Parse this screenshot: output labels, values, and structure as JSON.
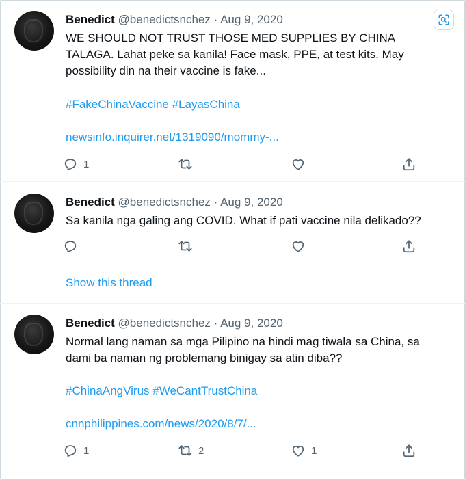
{
  "tweets": [
    {
      "name": "Benedict",
      "meta": "@benedictsnchez · Aug 9, 2020",
      "lines": [
        "WE SHOULD NOT TRUST THOSE MED SUPPLIES BY CHINA",
        "TALAGA. Lahat peke sa kanila! Face mask, PPE, at test kits. May",
        "possibility din na their vaccine is fake..."
      ],
      "hashtags": "#FakeChinaVaccine #LayasChina",
      "url": "newsinfo.inquirer.net/1319090/mommy-...",
      "reply_count": "1",
      "retweet_count": "",
      "like_count": ""
    },
    {
      "name": "Benedict",
      "meta": "@benedictsnchez · Aug 9, 2020",
      "lines": [
        "Sa kanila nga galing ang COVID. What if pati vaccine nila delikado??"
      ],
      "show_thread": "Show this thread",
      "reply_count": "",
      "retweet_count": "",
      "like_count": ""
    },
    {
      "name": "Benedict",
      "meta": "@benedictsnchez · Aug 9, 2020",
      "lines": [
        "Normal lang naman sa mga Pilipino na hindi mag tiwala sa China, sa",
        "dami ba naman ng problemang binigay sa atin diba??"
      ],
      "hashtags": "#ChinaAngVirus #WeCantTrustChina",
      "url": "cnnphilippines.com/news/2020/8/7/...",
      "reply_count": "1",
      "retweet_count": "2",
      "like_count": "1"
    }
  ],
  "icons": {
    "reply": "reply-icon",
    "retweet": "retweet-icon",
    "like": "heart-icon",
    "share": "share-icon",
    "lens": "visual-search-icon"
  },
  "colors": {
    "link": "#1d9bf0",
    "muted": "#536471",
    "text": "#0f1419"
  }
}
